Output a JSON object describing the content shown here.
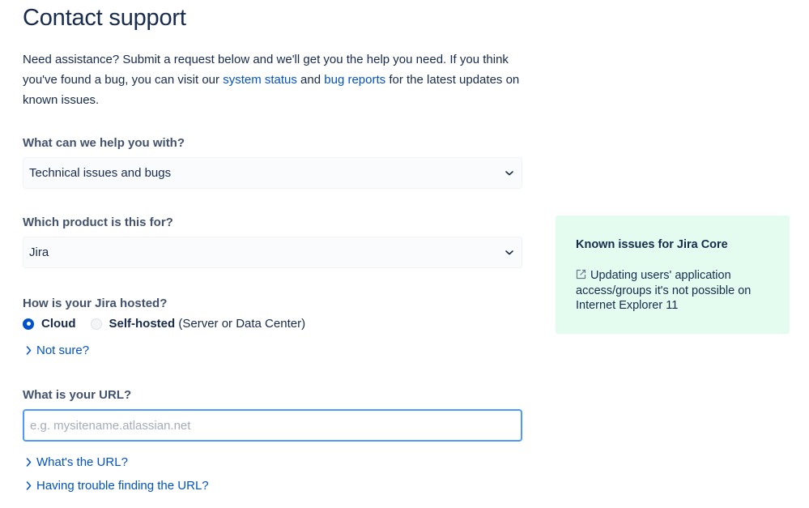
{
  "page": {
    "title": "Contact support",
    "intro": {
      "part1": "Need assistance? Submit a request below and we'll get you the help you need. If you think you've found a bug, you can visit our ",
      "link1": "system status",
      "part2": " and ",
      "link2": "bug reports",
      "part3": " for the latest updates on known issues."
    }
  },
  "form": {
    "help_with": {
      "label": "What can we help you with?",
      "selected": "Technical issues and bugs"
    },
    "product": {
      "label": "Which product is this for?",
      "selected": "Jira"
    },
    "hosting": {
      "label": "How is your Jira hosted?",
      "options": [
        {
          "label": "Cloud",
          "checked": true
        },
        {
          "label": "Self-hosted",
          "note": "(Server or Data Center)",
          "checked": false
        }
      ],
      "not_sure": "Not sure?"
    },
    "url": {
      "label": "What is your URL?",
      "placeholder": "e.g. mysitename.atlassian.net",
      "value": "",
      "help1": "What's the URL?",
      "help2": "Having trouble finding the URL?"
    }
  },
  "known_issues": {
    "title": "Known issues for Jira Core",
    "items": [
      {
        "text": "Updating users' application access/groups it's not possible on Internet Explorer 11",
        "icon": "external-link-icon"
      }
    ]
  },
  "colors": {
    "link": "#0052cc",
    "text": "#172b4d",
    "label": "#42526e",
    "focus_border": "#4c9aff",
    "known_bg": "#e3fcef"
  }
}
